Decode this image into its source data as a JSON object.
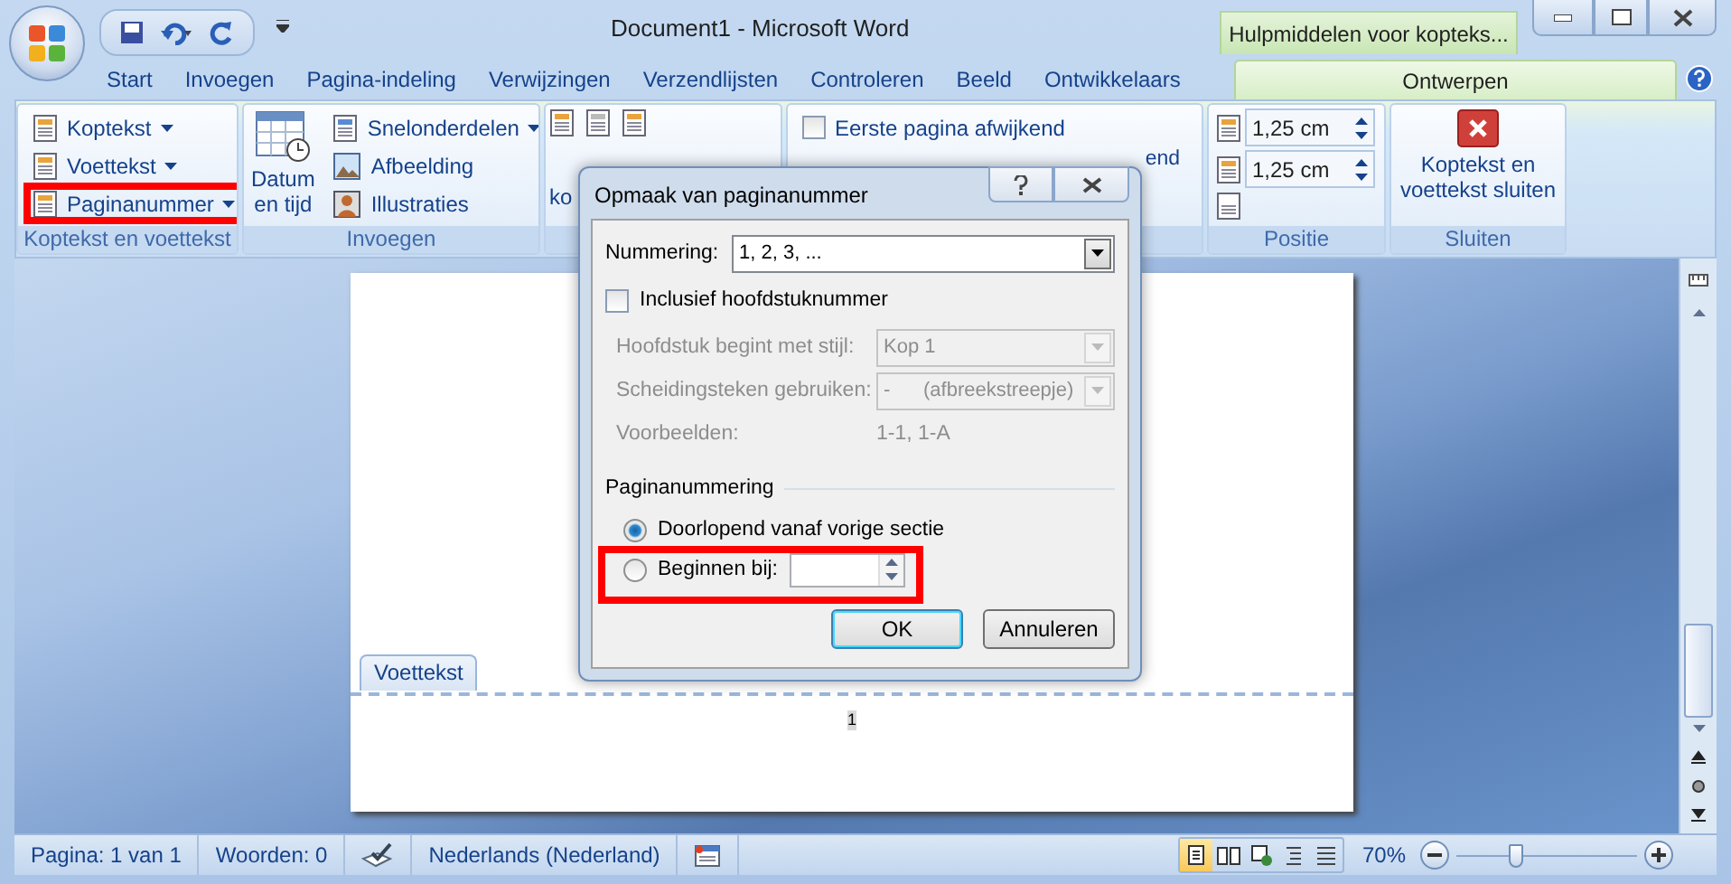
{
  "window": {
    "title": "Document1 - Microsoft Word",
    "context_tab": "Hulpmiddelen voor kopteks..."
  },
  "tabs": [
    {
      "label": "Start",
      "selected": false
    },
    {
      "label": "Invoegen",
      "selected": false
    },
    {
      "label": "Pagina-indeling",
      "selected": false
    },
    {
      "label": "Verwijzingen",
      "selected": false
    },
    {
      "label": "Verzendlijsten",
      "selected": false
    },
    {
      "label": "Controleren",
      "selected": false
    },
    {
      "label": "Beeld",
      "selected": false
    },
    {
      "label": "Ontwikkelaars",
      "selected": false
    },
    {
      "label": "Ontwerpen",
      "selected": true
    }
  ],
  "ribbon": [
    {
      "kind": "header-footer",
      "label": "Koptekst en voettekst",
      "items": [
        {
          "label": "Koptekst",
          "highlighted": false
        },
        {
          "label": "Voettekst",
          "highlighted": false
        },
        {
          "label": "Paginanummer",
          "highlighted": true
        }
      ]
    },
    {
      "kind": "insert",
      "label": "Invoegen",
      "large": "Datum en tijd",
      "items": [
        {
          "label": "Snelonderdelen",
          "dropdown": true
        },
        {
          "label": "Afbeelding",
          "dropdown": false
        },
        {
          "label": "Illustraties",
          "dropdown": false
        }
      ]
    },
    {
      "kind": "navigation",
      "text": "ko"
    },
    {
      "kind": "options",
      "items": [
        {
          "label": "Eerste pagina afwijkend",
          "checked": false
        }
      ],
      "partial": "end"
    },
    {
      "kind": "position",
      "label": "Positie",
      "spinners": [
        {
          "value": "1,25 cm"
        },
        {
          "value": "1,25 cm"
        }
      ]
    },
    {
      "kind": "close",
      "label": "Sluiten",
      "button": "Koptekst en voettekst sluiten"
    }
  ],
  "document": {
    "footer_tab": "Voettekst",
    "page_number": "1"
  },
  "dialog": {
    "title": "Opmaak van paginanummer",
    "numbering": {
      "label": "Nummering:",
      "value": "1, 2, 3, ..."
    },
    "chapter": {
      "label": "Inclusief hoofdstuknummer",
      "checked": false
    },
    "chapter_rows": [
      {
        "label": "Hoofdstuk begint met stijl:",
        "value": "Kop 1",
        "kind": "select",
        "disabled": true
      },
      {
        "label": "Scheidingsteken gebruiken:",
        "value": "-      (afbreekstreepje)",
        "kind": "select",
        "disabled": true
      },
      {
        "label": "Voorbeelden:",
        "value": "1-1, 1-A",
        "kind": "text",
        "disabled": true
      }
    ],
    "section": "Paginanummering",
    "radios": [
      {
        "label": "Doorlopend vanaf vorige sectie",
        "selected": true,
        "highlighted": false,
        "kind": "plain"
      },
      {
        "label": "Beginnen bij:",
        "selected": false,
        "highlighted": true,
        "kind": "spinner"
      }
    ],
    "buttons": [
      {
        "label": "OK",
        "default": true
      },
      {
        "label": "Annuleren",
        "default": false
      }
    ]
  },
  "status_bar": {
    "page": "Pagina: 1 van 1",
    "words": "Woorden: 0",
    "language": "Nederlands (Nederland)",
    "views": [
      {
        "kind": "print",
        "selected": true
      },
      {
        "kind": "reading",
        "selected": false
      },
      {
        "kind": "web",
        "selected": false
      },
      {
        "kind": "outline",
        "selected": false
      },
      {
        "kind": "draft",
        "selected": false
      }
    ],
    "zoom": "70%",
    "zoom_slider": {
      "level": 0.33
    }
  }
}
